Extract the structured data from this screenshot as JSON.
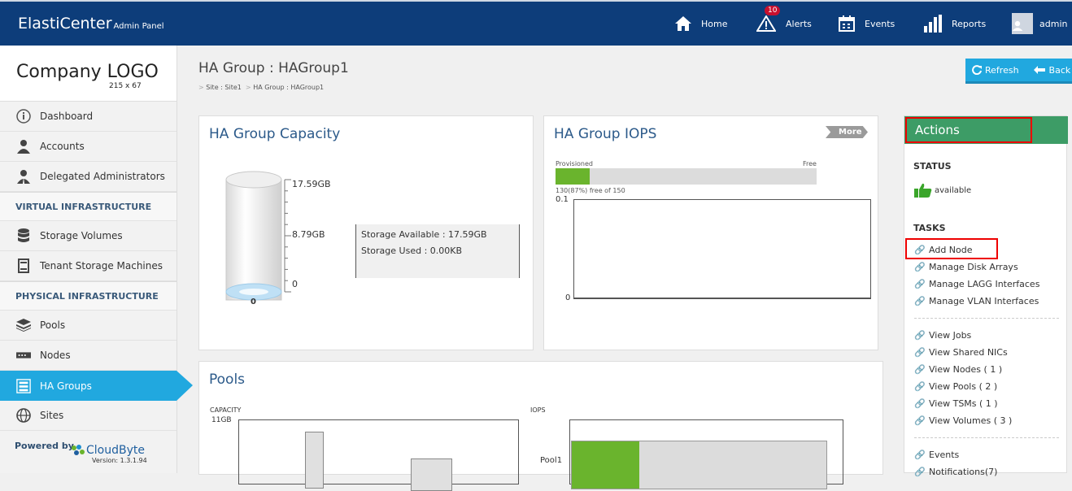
{
  "header": {
    "brand": "ElastiCenter",
    "brand_sub": "Admin Panel",
    "nav": [
      {
        "label": "Home",
        "icon": "home-icon"
      },
      {
        "label": "Alerts",
        "icon": "alert-icon",
        "badge": "10"
      },
      {
        "label": "Events",
        "icon": "calendar-icon"
      },
      {
        "label": "Reports",
        "icon": "bar-chart-icon"
      },
      {
        "label": "admin",
        "icon": "user-avatar"
      }
    ]
  },
  "sidebar": {
    "logo_text": "Company LOGO",
    "logo_size": "215 x 67",
    "items": [
      {
        "label": "Dashboard",
        "icon": "info-icon"
      },
      {
        "label": "Accounts",
        "icon": "user-icon"
      },
      {
        "label": "Delegated Administrators",
        "icon": "admin-user-icon"
      }
    ],
    "section_virtual": "VIRTUAL INFRASTRUCTURE",
    "virtual_items": [
      {
        "label": "Storage Volumes",
        "icon": "database-icon"
      },
      {
        "label": "Tenant Storage Machines",
        "icon": "server-icon"
      }
    ],
    "section_physical": "PHYSICAL INFRASTRUCTURE",
    "physical_items": [
      {
        "label": "Pools",
        "icon": "layers-icon"
      },
      {
        "label": "Nodes",
        "icon": "node-icon"
      },
      {
        "label": "HA Groups",
        "icon": "ha-group-icon",
        "active": true
      },
      {
        "label": "Sites",
        "icon": "globe-icon"
      }
    ],
    "powered_by": "Powered by",
    "vendor": "CloudByte",
    "version": "Version: 1.3.1.94"
  },
  "page": {
    "title": "HA Group : HAGroup1",
    "breadcrumb": [
      "Site : Site1",
      "HA Group : HAGroup1"
    ],
    "refresh_label": "Refresh",
    "back_label": "Back"
  },
  "capacity_panel": {
    "title": "HA Group Capacity",
    "scale_top": "17.59GB",
    "scale_mid": "8.79GB",
    "scale_bottom": "0",
    "cylinder_value": "0",
    "used_fraction": 0.0,
    "storage_available": "Storage Available : 17.59GB",
    "storage_used": "Storage Used : 0.00KB"
  },
  "iops_panel": {
    "title": "HA Group IOPS",
    "more_label": "More",
    "provisioned_label": "Provisioned",
    "free_label": "Free",
    "provisioned_fraction": 0.13,
    "free_text": "130(87%) free of 150",
    "y_top": "0.1",
    "y_bottom": "0"
  },
  "pools_panel": {
    "title": "Pools",
    "capacity_label": "CAPACITY",
    "capacity_top_tick": "11GB",
    "iops_label": "IOPS",
    "pool_label": "Pool1"
  },
  "actions": {
    "title": "Actions",
    "status_label": "STATUS",
    "status_value": "available",
    "tasks_label": "TASKS",
    "tasks": [
      "Add Node",
      "Manage Disk Arrays",
      "Manage LAGG Interfaces",
      "Manage VLAN Interfaces"
    ],
    "views": [
      "View Jobs",
      "View Shared NICs",
      "View Nodes ( 1 )",
      "View Pools ( 2 )",
      "View TSMs ( 1 )",
      "View Volumes ( 3 )"
    ],
    "extra": [
      "Events",
      "Notifications(7)"
    ]
  },
  "colors": {
    "topbar": "#0d3d7a",
    "accent": "#21a8df",
    "actions_header": "#3d9c66",
    "provisioned": "#6ab42d"
  }
}
